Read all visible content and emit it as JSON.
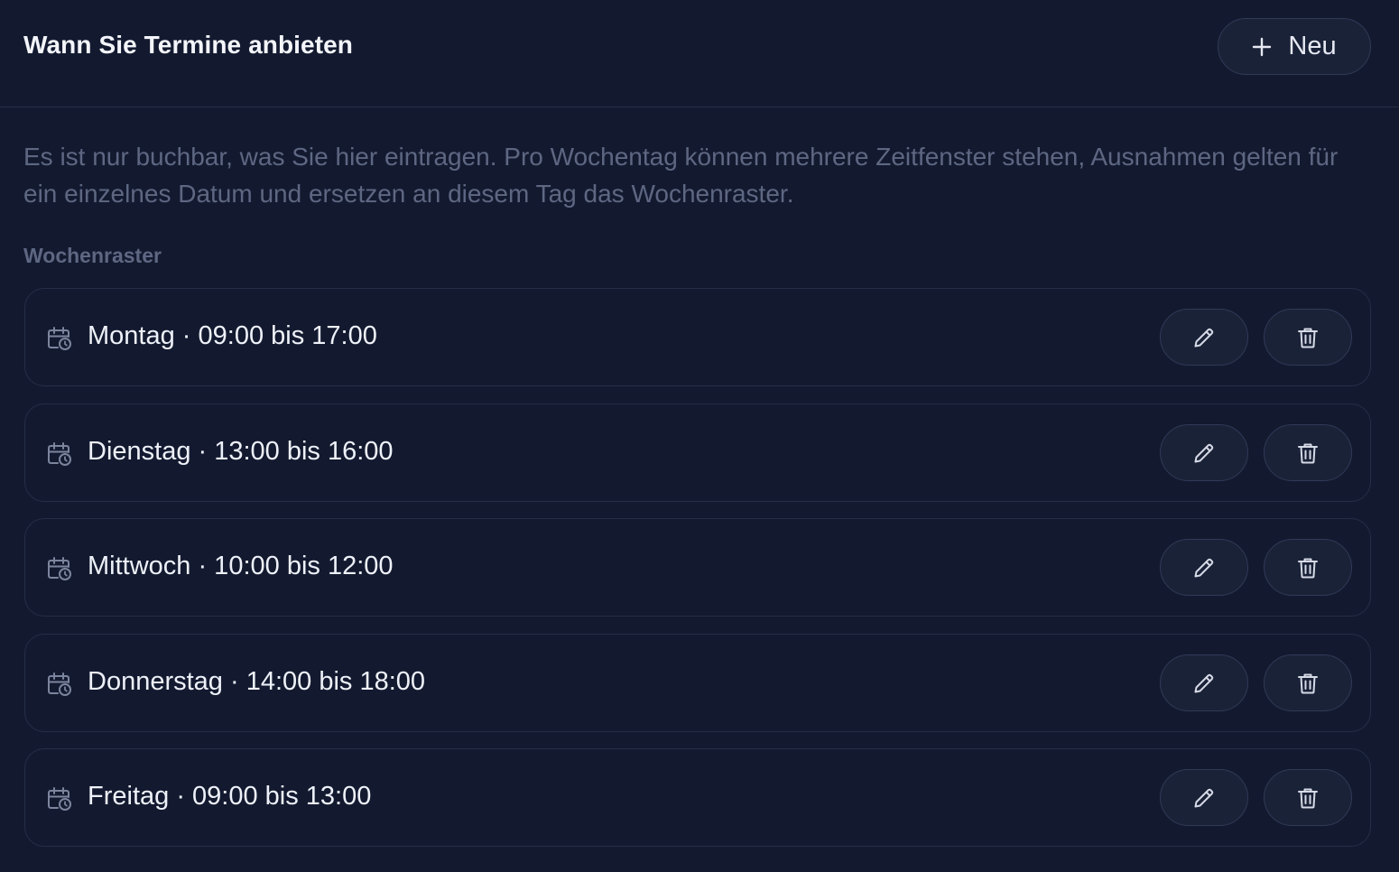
{
  "header": {
    "title": "Wann Sie Termine anbieten",
    "new_button_label": "Neu"
  },
  "description": "Es ist nur buchbar, was Sie hier eintragen. Pro Wochentag können mehrere Zeitfenster stehen, Ausnahmen gelten für ein einzelnes Datum und ersetzen an diesem Tag das Wochenraster.",
  "section_label": "Wochenraster",
  "slots": [
    {
      "text": "Montag · 09:00 bis 17:00"
    },
    {
      "text": "Dienstag · 13:00 bis 16:00"
    },
    {
      "text": "Mittwoch · 10:00 bis 12:00"
    },
    {
      "text": "Donnerstag · 14:00 bis 18:00"
    },
    {
      "text": "Freitag · 09:00 bis 13:00"
    }
  ],
  "icons": {
    "new": "plus-icon",
    "slot": "calendar-clock-icon",
    "edit": "pencil-icon",
    "delete": "trash-icon"
  },
  "colors": {
    "background": "#131a30",
    "border": "#252e47",
    "button_bg": "#1a2238",
    "muted_text": "#5e6782",
    "text": "#eef1f8"
  }
}
